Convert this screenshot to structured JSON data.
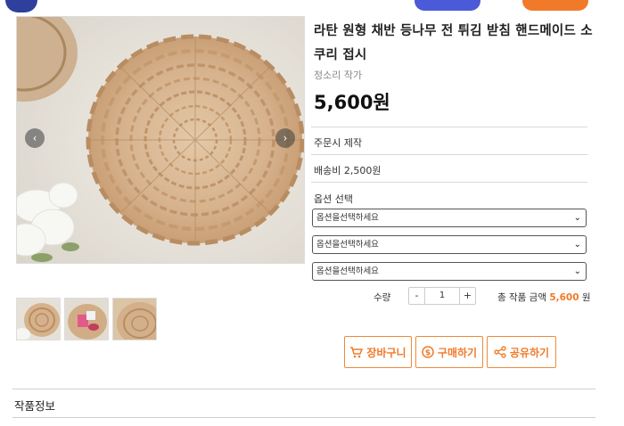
{
  "product": {
    "title": "라탄 원형 채반 등나무 전 튀김 받침 핸드메이드 소쿠리 접시",
    "artist": "정소리 작가",
    "price": "5,600원",
    "custom_order": "주문시 제작",
    "shipping": "배송비 2,500원"
  },
  "options": {
    "label": "옵션 선택",
    "selects": [
      {
        "value": "옵션을선택하세요"
      },
      {
        "value": "옵션을선택하세요"
      },
      {
        "value": "옵션을선택하세요"
      }
    ]
  },
  "quantity": {
    "label": "수량",
    "minus": "-",
    "value": "1",
    "plus": "+"
  },
  "total": {
    "label": "총 작품 금액",
    "amount": "5,600",
    "unit": "원"
  },
  "actions": {
    "cart": "장바구니",
    "buy": "구매하기",
    "share": "공유하기"
  },
  "gallery": {
    "prev": "‹",
    "next": "›"
  },
  "tabs": {
    "product_info": "작품정보"
  },
  "icons": [
    "cart-icon",
    "coin-icon",
    "share-icon",
    "chevron-down-icon",
    "chevron-left-icon",
    "chevron-right-icon"
  ],
  "colors": {
    "accent": "#f07a2a",
    "text": "#222222",
    "muted": "#888888",
    "border": "#d8d8d8"
  }
}
